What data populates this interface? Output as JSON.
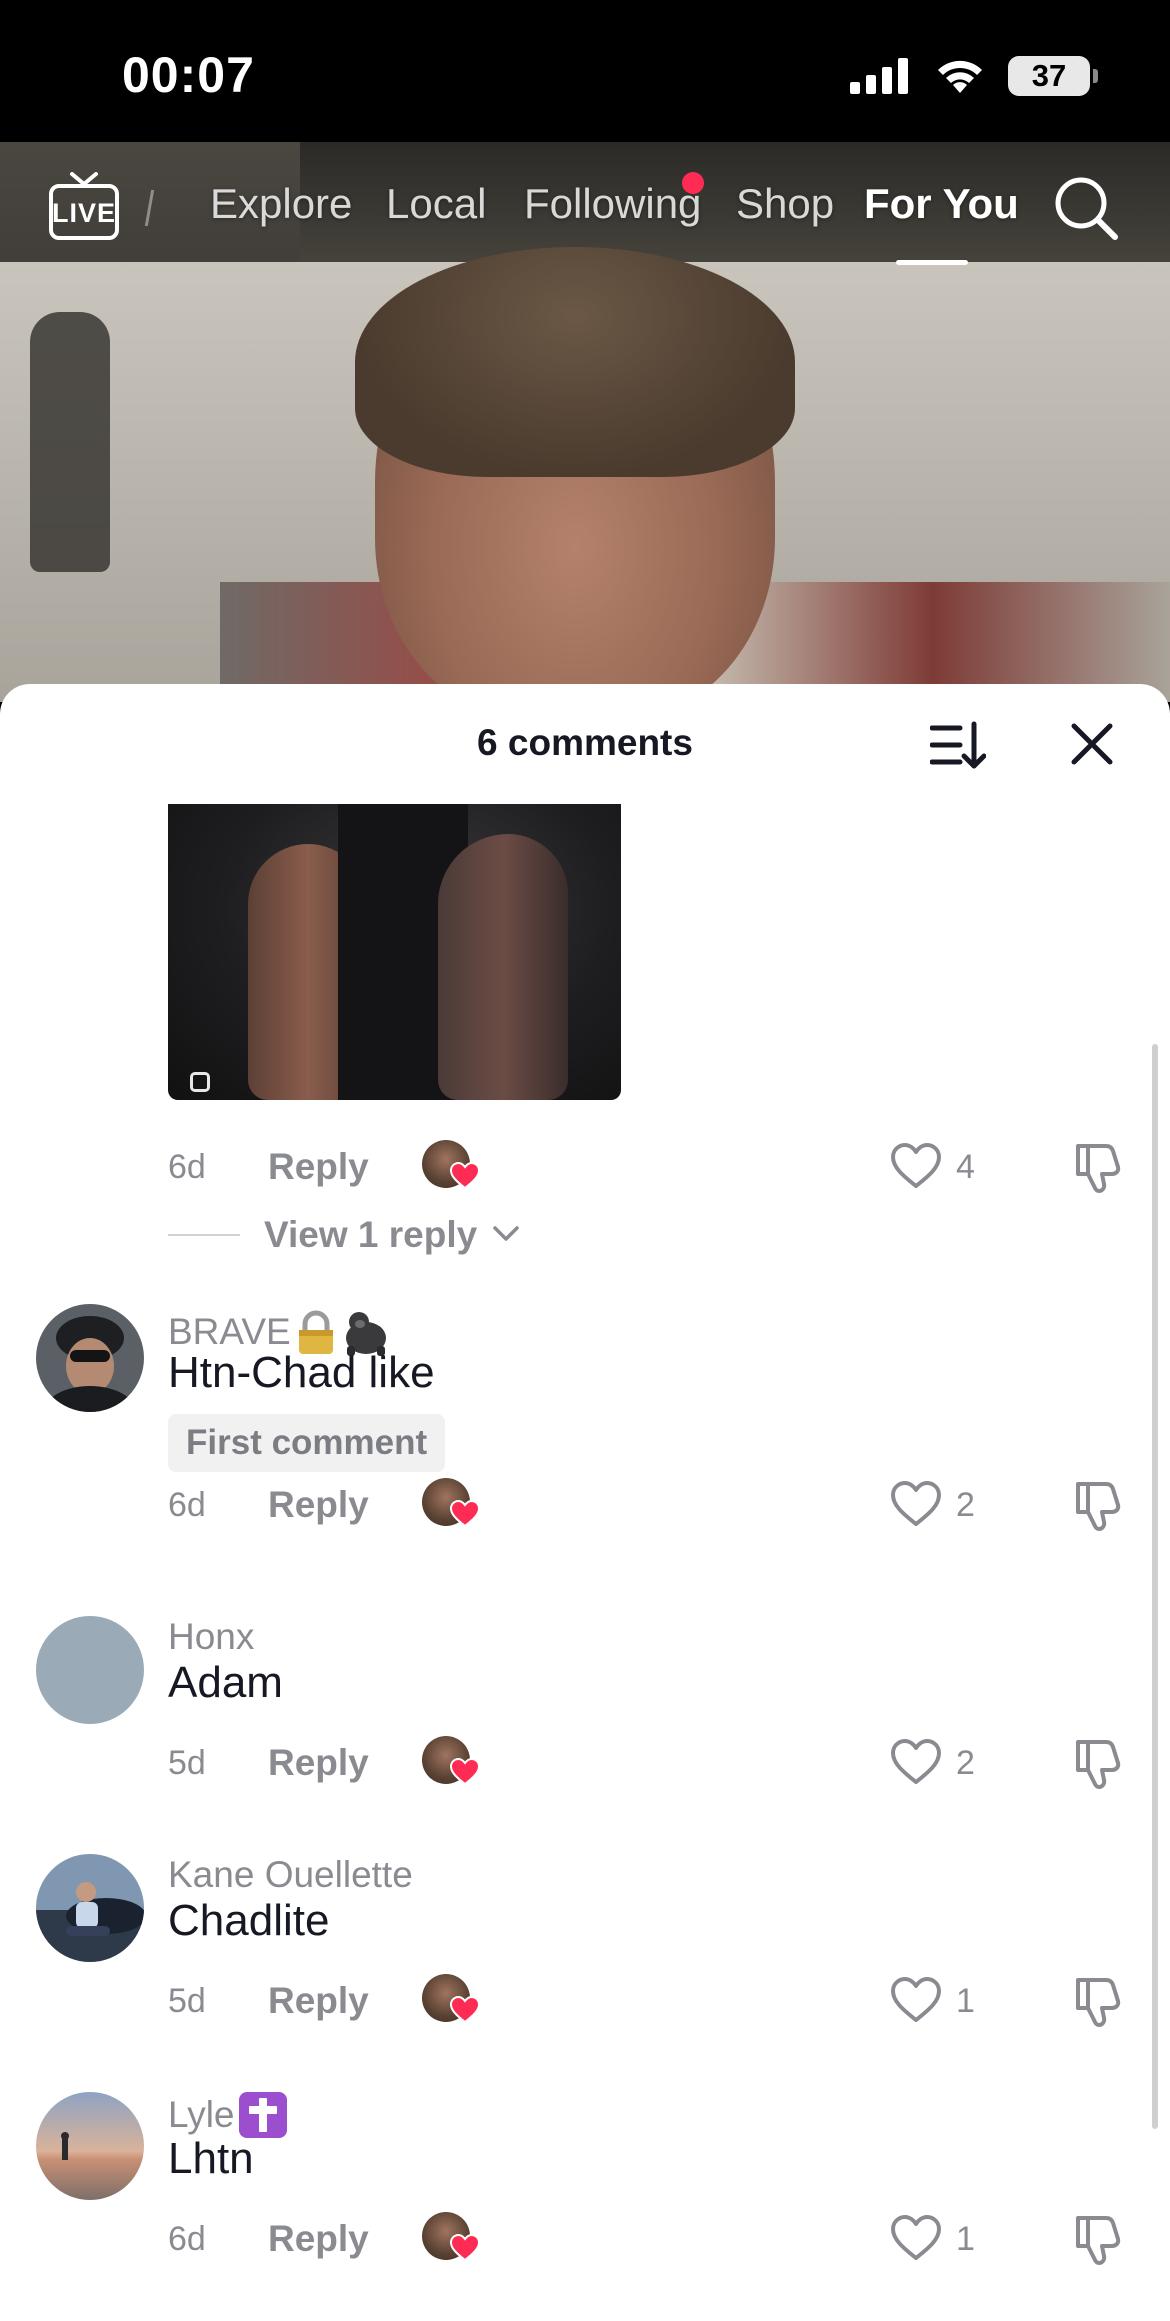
{
  "status_bar": {
    "time": "00:07",
    "battery": "37"
  },
  "top_nav": {
    "live_label": "LIVE",
    "tabs": [
      {
        "label": "Explore"
      },
      {
        "label": "Local"
      },
      {
        "label": "Following"
      },
      {
        "label": "Shop"
      },
      {
        "label": "For You"
      }
    ],
    "active_tab": "For You",
    "accent_color": "#fe2c55"
  },
  "comments_sheet": {
    "title": "6 comments",
    "first_comment_partial": {
      "time": "6d",
      "reply_label": "Reply",
      "likes": "4",
      "view_replies": "View 1 reply"
    },
    "comments": [
      {
        "username": "BRAVE",
        "username_emoji": [
          "lock",
          "gorilla"
        ],
        "text": "Htn-Chad like",
        "badge": "First comment",
        "time": "6d",
        "reply_label": "Reply",
        "likes": "2"
      },
      {
        "username": "Honx",
        "text": "Adam",
        "time": "5d",
        "reply_label": "Reply",
        "likes": "2"
      },
      {
        "username": "Kane Ouellette",
        "text": "Chadlite",
        "time": "5d",
        "reply_label": "Reply",
        "likes": "1"
      },
      {
        "username": "Lyle",
        "username_emoji": [
          "latin-cross"
        ],
        "text": "Lhtn",
        "time": "6d",
        "reply_label": "Reply",
        "likes": "1"
      }
    ]
  }
}
